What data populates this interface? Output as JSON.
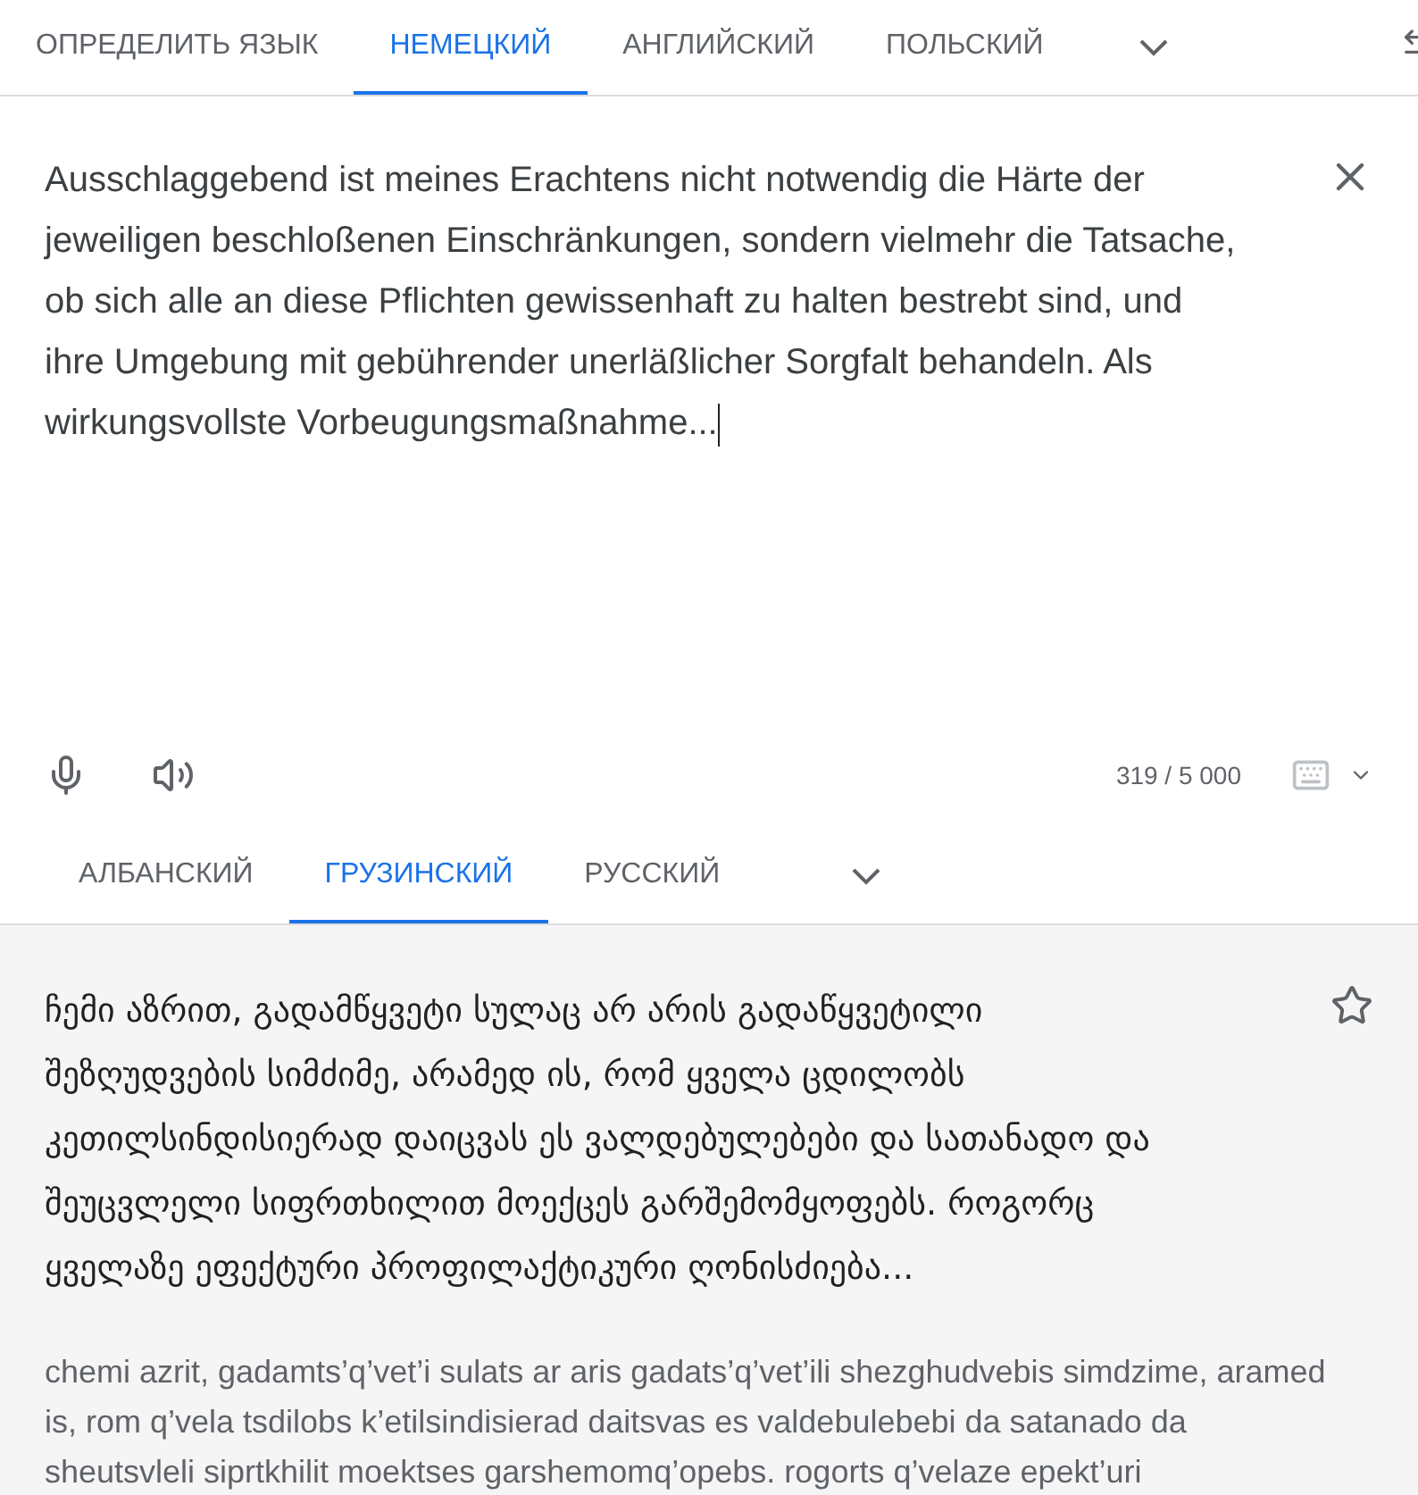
{
  "source_tabs": [
    {
      "label": "ОПРЕДЕЛИТЬ ЯЗЫК",
      "selected": false
    },
    {
      "label": "НЕМЕЦКИЙ",
      "selected": true
    },
    {
      "label": "АНГЛИЙСКИЙ",
      "selected": false
    },
    {
      "label": "ПОЛЬСКИЙ",
      "selected": false
    }
  ],
  "source_text": "Ausschlaggebend ist meines Erachtens nicht notwendig die Härte der jeweiligen beschloßenen Einschränkungen, sondern vielmehr die Tatsache, ob sich alle an diese Pflichten gewissenhaft zu halten bestrebt sind, und ihre Umgebung mit gebührender unerläßlicher Sorgfalt behandeln. Als wirkungsvollste Vorbeugungsmaßnahme...",
  "char_count": "319 / 5 000",
  "target_tabs": [
    {
      "label": "АЛБАНСКИЙ",
      "selected": false
    },
    {
      "label": "ГРУЗИНСКИЙ",
      "selected": true
    },
    {
      "label": "РУССКИЙ",
      "selected": false
    }
  ],
  "translation": "ჩემი აზრით, გადამწყვეტი სულაც არ არის გადაწყვეტილი შეზღუდვების სიმძიმე, არამედ ის, რომ ყველა ცდილობს კეთილსინდისიერად დაიცვას ეს ვალდებულებები და სათანადო და შეუცვლელი სიფრთხილით მოექცეს გარშემომყოფებს. როგორც ყველაზე ეფექტური პროფილაქტიკური ღონისძიება...",
  "transliteration": "chemi azrit, gadamts’q’vet’i sulats ar aris gadats’q’vet’ili shezghudvebis simdzime, aramed is, rom q’vela tsdilobs k’etilsindisierad daitsvas es valdebulebebi da satanado da sheutsvleli siprtkhilit moektses garshemomq’opebs. rogorts q’velaze epekt’uri"
}
